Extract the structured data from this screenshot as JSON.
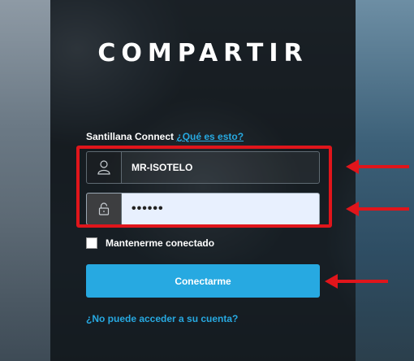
{
  "brand": {
    "logo_text": "COMPARTIR"
  },
  "login": {
    "connect_label": "Santillana Connect",
    "help_link": "¿Qué es esto?",
    "username_value": "MR-ISOTELO",
    "password_value": "••••••",
    "remember_label": "Mantenerme conectado",
    "remember_checked": false,
    "submit_label": "Conectarme",
    "forgot_link": "¿No puede acceder a su cuenta?"
  },
  "icons": {
    "username": "user-icon",
    "password": "lock-icon"
  },
  "colors": {
    "accent": "#27a9e1",
    "annotation": "#e0151b",
    "panel": "#141619"
  }
}
